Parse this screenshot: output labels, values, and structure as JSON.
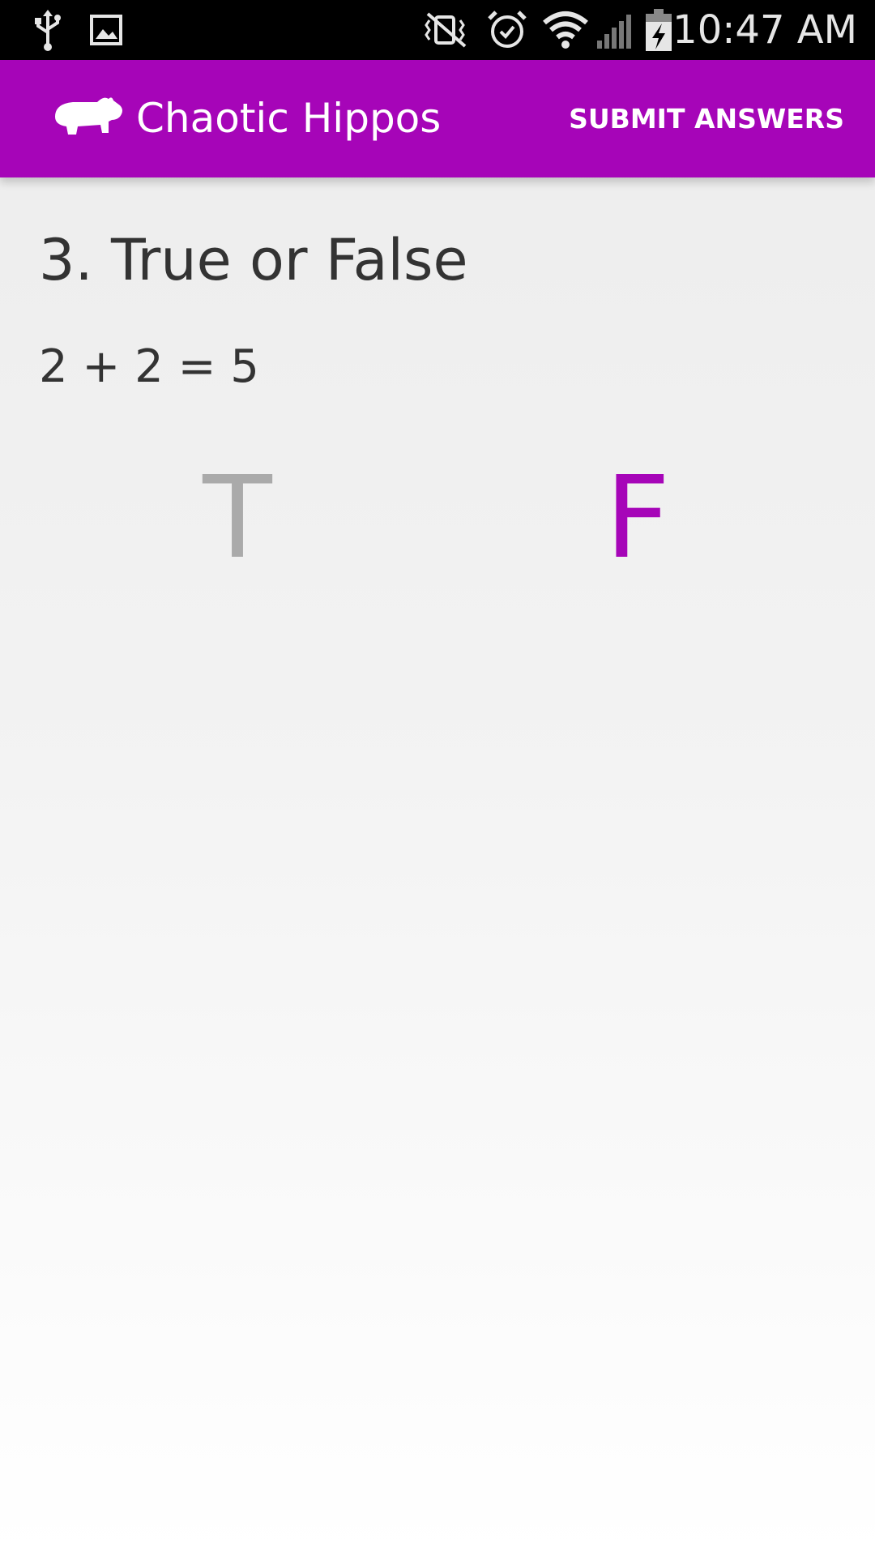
{
  "status_bar": {
    "time": "10:47 AM",
    "icons": [
      "usb-icon",
      "image-icon",
      "vibrate-mute-icon",
      "alarm-icon",
      "wifi-icon",
      "signal-icon",
      "battery-charging-icon"
    ]
  },
  "app_bar": {
    "logo": "hippo-icon",
    "title": "Chaotic Hippos",
    "submit_label": "SUBMIT ANSWERS"
  },
  "question": {
    "title": "3. True or False",
    "text": "2 + 2 = 5",
    "options": [
      {
        "label": "T",
        "selected": false
      },
      {
        "label": "F",
        "selected": true
      }
    ]
  },
  "colors": {
    "accent": "#a605b8",
    "unselected": "#aaaaaa",
    "text": "#333333"
  }
}
